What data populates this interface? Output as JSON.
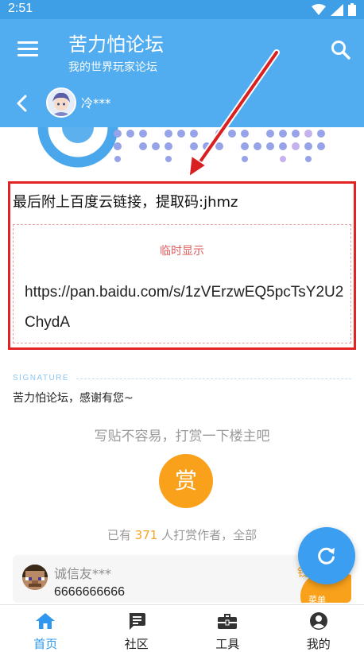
{
  "status_bar": {
    "time": "2:51"
  },
  "app_bar": {
    "title": "苦力怕论坛",
    "subtitle": "我的世界玩家论坛"
  },
  "thread_header": {
    "author": "冷***"
  },
  "post": {
    "intro": "最后附上百度云链接，提取码:jhmz",
    "hidden_label": "临时显示",
    "link": "https://pan.baidu.com/s/1zVErzwEQ5pcTsY2U2ChydA"
  },
  "signature": {
    "label": "SIGNATURE",
    "text": "苦力怕论坛，感谢有您~"
  },
  "reward": {
    "prompt": "写贴不容易，打赏一下楼主吧",
    "button_label": "赏",
    "count_prefix": "已有",
    "count": "371",
    "count_suffix": "人打赏作者，全部"
  },
  "comment": {
    "username": "诚信友***",
    "text": "6666666666",
    "badge_top": "钱",
    "badge_label": "菜单"
  },
  "bottom_nav": [
    {
      "label": "首页",
      "icon": "home-icon",
      "active": true
    },
    {
      "label": "社区",
      "icon": "chat-icon",
      "active": false
    },
    {
      "label": "工具",
      "icon": "toolbox-icon",
      "active": false
    },
    {
      "label": "我的",
      "icon": "account-icon",
      "active": false
    }
  ],
  "colors": {
    "primary": "#52adf0",
    "status_bar": "#3f9fe6",
    "accent_orange": "#f9a11b",
    "annotation_red": "#e32323",
    "nav_active": "#2f98ee"
  }
}
